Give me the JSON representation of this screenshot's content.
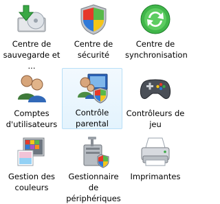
{
  "items": [
    {
      "label": "Centre de sauvegarde et ...",
      "icon": "backup-center-icon",
      "selected": false
    },
    {
      "label": "Centre de sécurité",
      "icon": "security-center-shield-icon",
      "selected": false
    },
    {
      "label": "Centre de synchronisation",
      "icon": "sync-center-icon",
      "selected": false
    },
    {
      "label": "Comptes d'utilisateurs",
      "icon": "user-accounts-icon",
      "selected": false
    },
    {
      "label": "Contrôle parental",
      "icon": "parental-controls-icon",
      "selected": true
    },
    {
      "label": "Contrôleurs de jeu",
      "icon": "game-controller-icon",
      "selected": false
    },
    {
      "label": "Gestion des couleurs",
      "icon": "color-management-icon",
      "selected": false
    },
    {
      "label": "Gestionnaire de périphériques",
      "icon": "device-manager-icon",
      "selected": false
    },
    {
      "label": "Imprimantes",
      "icon": "printer-icon",
      "selected": false
    }
  ],
  "colors": {
    "selection_bg": "#e3f3fd",
    "selection_border": "#b7dff7"
  }
}
